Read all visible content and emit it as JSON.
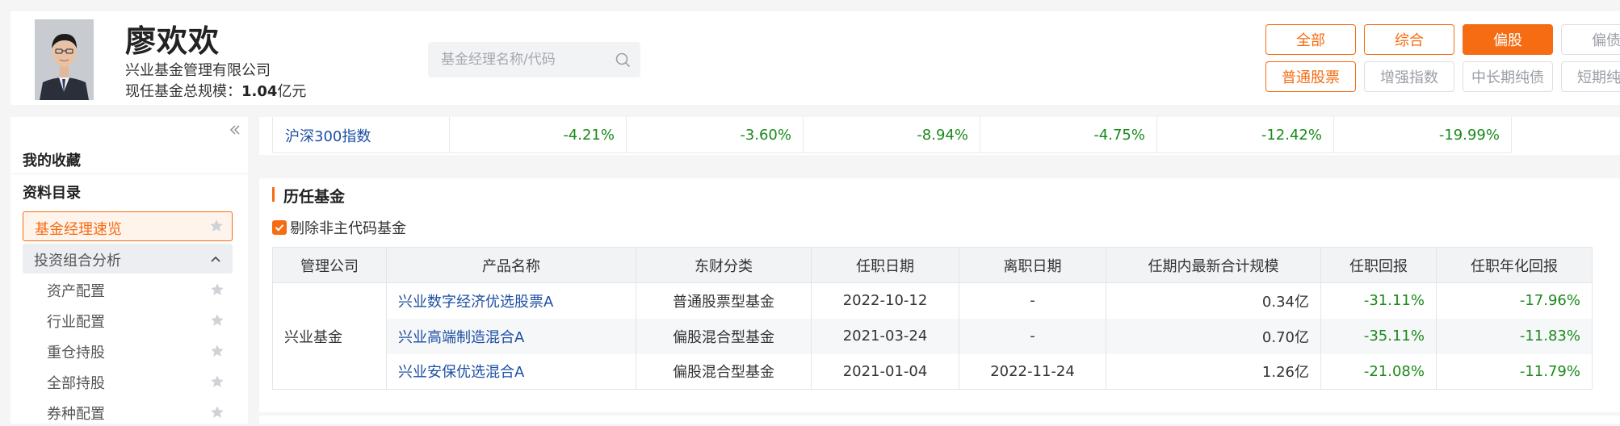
{
  "header": {
    "manager_name": "廖欢欢",
    "company": "兴业基金管理有限公司",
    "scale_label": "现任基金总规模：",
    "scale_value": "1.04",
    "scale_unit": "亿元",
    "search_placeholder": "基金经理名称/代码"
  },
  "filters": {
    "row1": [
      {
        "label": "全部",
        "state": "outline"
      },
      {
        "label": "综合",
        "state": "outline"
      },
      {
        "label": "偏股",
        "state": "active"
      },
      {
        "label": "偏债",
        "state": "gray"
      }
    ],
    "row2": [
      {
        "label": "普通股票",
        "state": "outline"
      },
      {
        "label": "增强指数",
        "state": "gray"
      },
      {
        "label": "中长期纯债",
        "state": "gray"
      },
      {
        "label": "短期纯债",
        "state": "gray"
      }
    ]
  },
  "sidebar": {
    "favorites": "我的收藏",
    "catalog": "资料目录",
    "active_item": "基金经理速览",
    "group": "投资组合分析",
    "items": [
      "资产配置",
      "行业配置",
      "重仓持股",
      "全部持股",
      "券种配置"
    ]
  },
  "index_row": {
    "name": "沪深300指数",
    "values": [
      "-4.21%",
      "-3.60%",
      "-8.94%",
      "-4.75%",
      "-12.42%",
      "-19.99%"
    ]
  },
  "history": {
    "title": "历任基金",
    "checkbox_label": "剔除非主代码基金",
    "checkbox_checked": true,
    "columns": [
      "管理公司",
      "产品名称",
      "东财分类",
      "任职日期",
      "离职日期",
      "任期内最新合计规模",
      "任职回报",
      "任职年化回报"
    ],
    "company": "兴业基金",
    "rows": [
      {
        "name": "兴业数字经济优选股票A",
        "category": "普通股票型基金",
        "start": "2022-10-12",
        "end": "-",
        "scale": "0.34亿",
        "return": "-31.11%",
        "annual": "-17.96%"
      },
      {
        "name": "兴业高端制造混合A",
        "category": "偏股混合型基金",
        "start": "2021-03-24",
        "end": "-",
        "scale": "0.70亿",
        "return": "-35.11%",
        "annual": "-11.83%"
      },
      {
        "name": "兴业安保优选混合A",
        "category": "偏股混合型基金",
        "start": "2021-01-04",
        "end": "2022-11-24",
        "scale": "1.26亿",
        "return": "-21.08%",
        "annual": "-11.79%"
      }
    ]
  },
  "colors": {
    "accent": "#f56c12",
    "link": "#1d4fa3",
    "negative": "#1a8a1a"
  }
}
